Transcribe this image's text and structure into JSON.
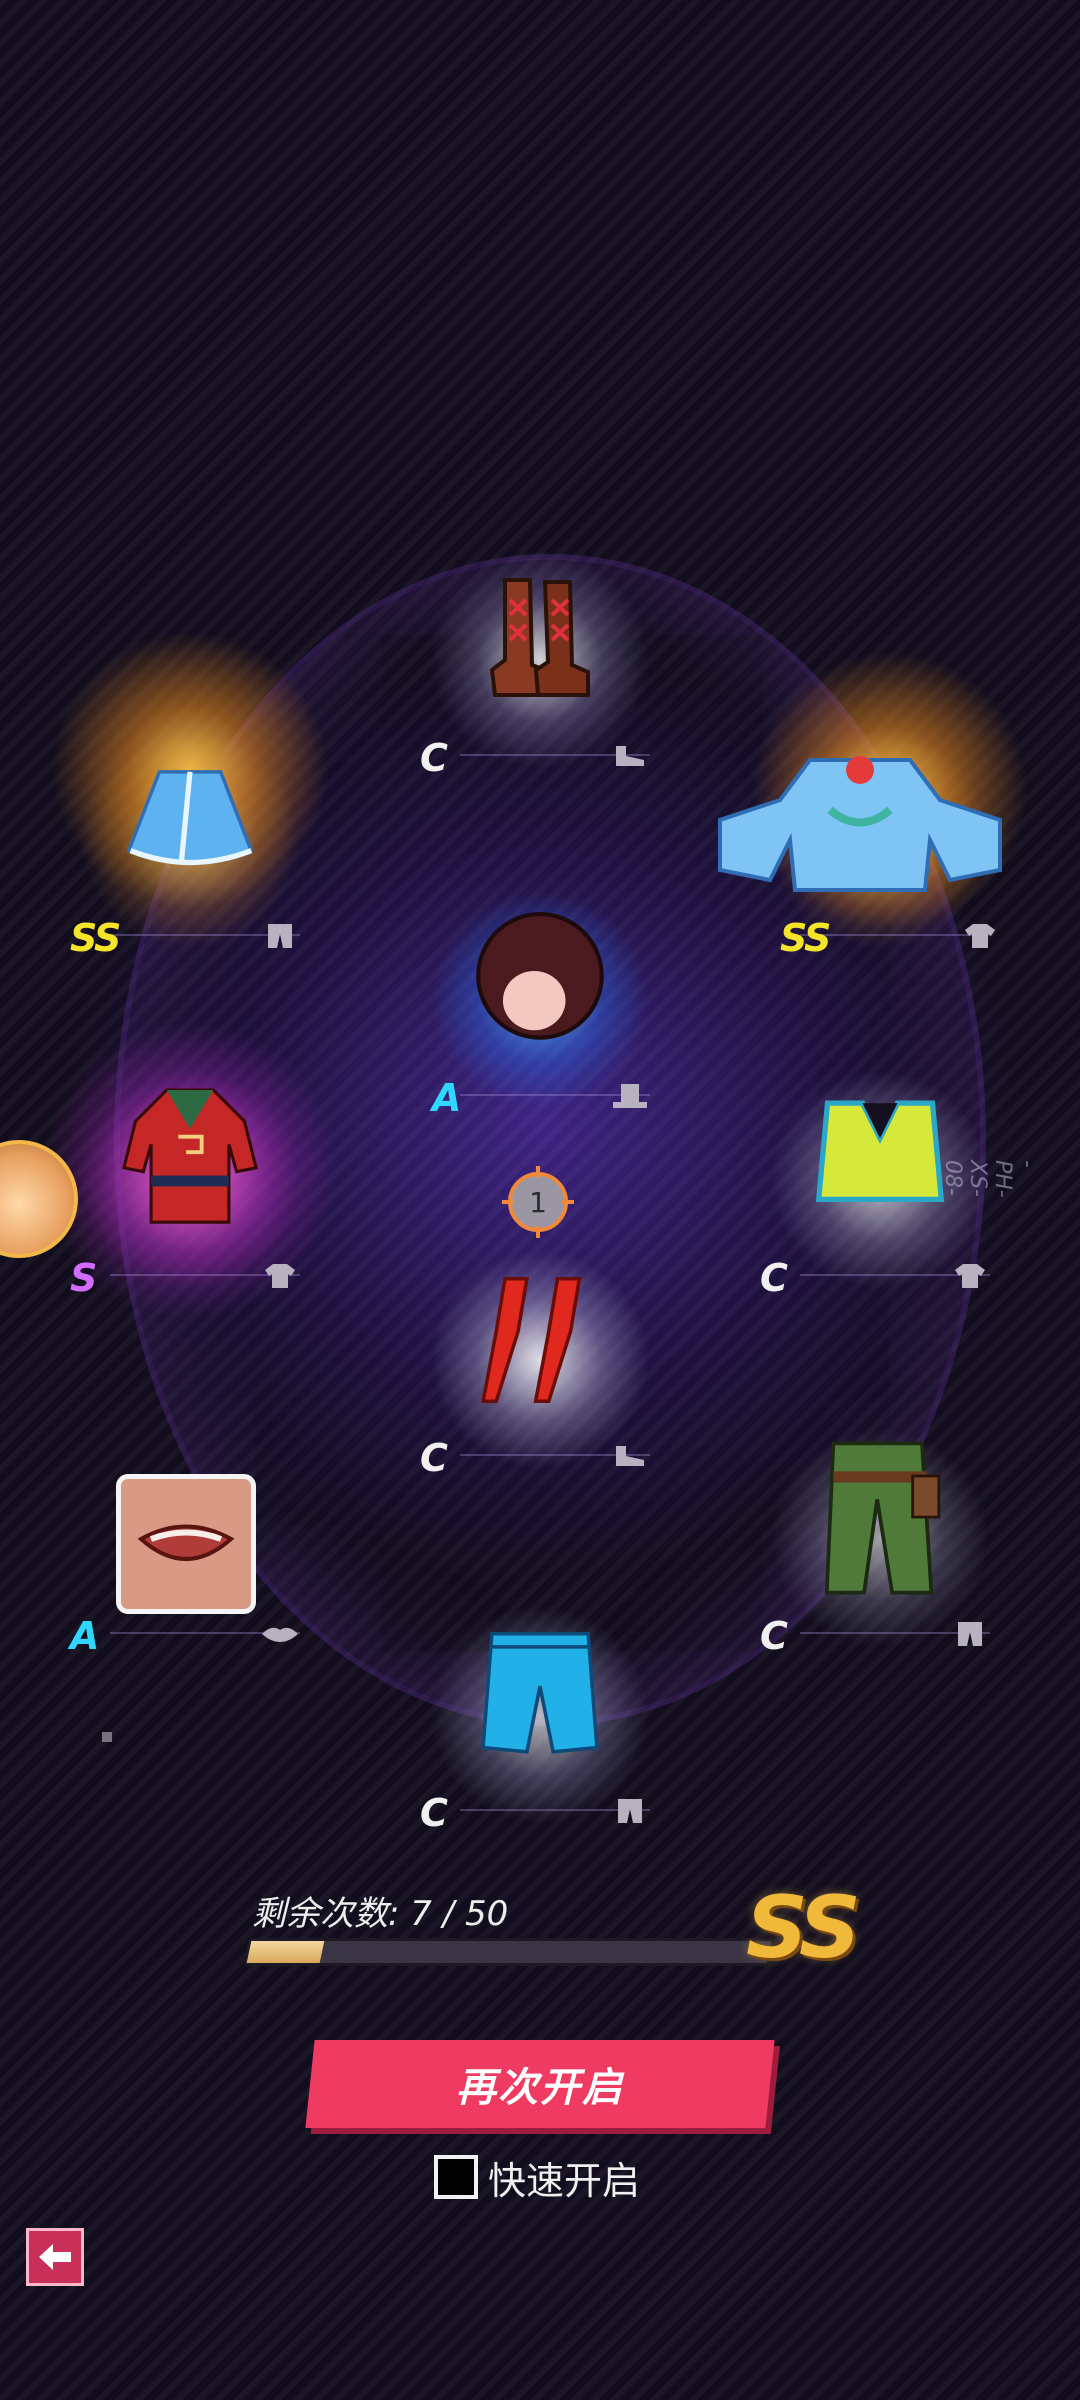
{
  "slots": [
    {
      "name": "boots",
      "rank": "C",
      "category_icon": "shoe-icon"
    },
    {
      "name": "blue-skirt",
      "rank": "SS",
      "category_icon": "pants-icon"
    },
    {
      "name": "blue-jacket",
      "rank": "SS",
      "category_icon": "shirt-icon"
    },
    {
      "name": "hair",
      "rank": "A",
      "category_icon": "hat-icon"
    },
    {
      "name": "red-outfit",
      "rank": "S",
      "category_icon": "shirt-icon"
    },
    {
      "name": "sports-bra",
      "rank": "C",
      "category_icon": "shirt-icon"
    },
    {
      "name": "red-heels",
      "rank": "C",
      "category_icon": "shoe-icon"
    },
    {
      "name": "mouth",
      "rank": "A",
      "category_icon": "lips-icon"
    },
    {
      "name": "green-cargo",
      "rank": "C",
      "category_icon": "pants-icon"
    },
    {
      "name": "blue-shorts",
      "rank": "C",
      "category_icon": "pants-icon"
    }
  ],
  "target_marker": "1",
  "side_tag": "-PH-XS-08-",
  "progress": {
    "label": "剩余次数: 7 / 50",
    "current": 7,
    "total": 50,
    "goal_rank": "SS"
  },
  "buttons": {
    "reopen": "再次开启",
    "quick_open": "快速开启"
  },
  "colors": {
    "rank_SS": "#f4e52b",
    "rank_S": "#d26cff",
    "rank_A": "#2fd6ff",
    "rank_C": "#f0f0f0",
    "button": "#ef3a62"
  }
}
